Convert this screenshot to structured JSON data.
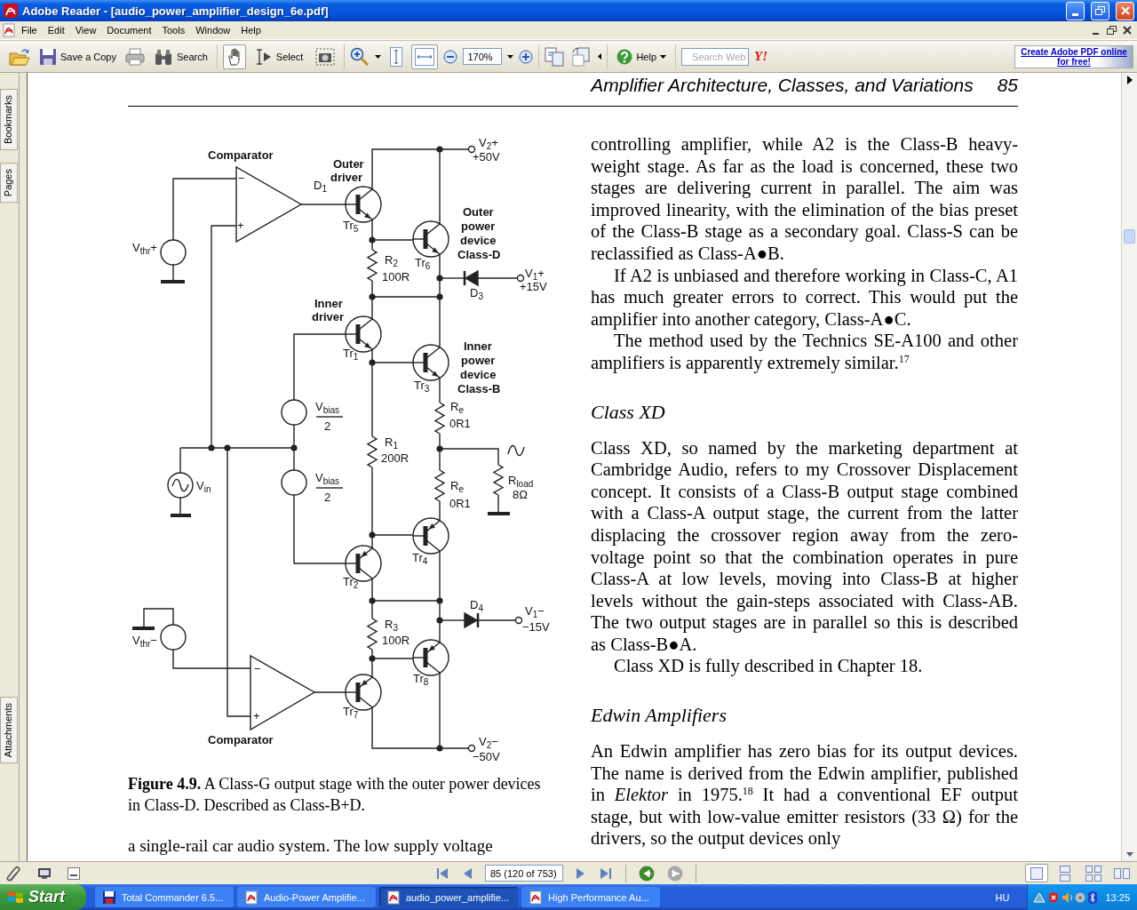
{
  "window": {
    "title": "Adobe Reader - [audio_power_amplifier_design_6e.pdf]"
  },
  "menu": [
    "File",
    "Edit",
    "View",
    "Document",
    "Tools",
    "Window",
    "Help"
  ],
  "toolbar": {
    "save_copy": "Save a Copy",
    "search": "Search",
    "tools": [
      {
        "kind": "hand",
        "selected": true
      },
      {
        "kind": "select",
        "label": "Select",
        "selected": false
      },
      {
        "kind": "snapshot",
        "selected": false
      }
    ],
    "fit": [
      {
        "kind": "page",
        "selected": false
      },
      {
        "kind": "width",
        "selected": true
      }
    ],
    "zoom": "170%",
    "help": "Help",
    "web_search": {
      "placeholder": "Search Web"
    },
    "web_logo": "Y!",
    "promo": "Create Adobe PDF online for free!"
  },
  "navigation_panel": {
    "tabs": [
      "Bookmarks",
      "Pages",
      "Attachments"
    ]
  },
  "page": {
    "header": {
      "title": "Amplifier Architecture, Classes, and Variations",
      "number": "85"
    },
    "figure": {
      "labels": [
        {
          "text": "Comparator",
          "kind": "caption"
        },
        {
          "text": "Outer",
          "kind": "caption"
        },
        {
          "text": "driver",
          "kind": "caption"
        },
        {
          "text": "D$_{1}$",
          "kind": "symbol"
        },
        {
          "text": "Tr$_{5}$",
          "kind": "symbol"
        },
        {
          "text": "Outer",
          "kind": "caption"
        },
        {
          "text": "power",
          "kind": "caption"
        },
        {
          "text": "device",
          "kind": "caption"
        },
        {
          "text": "Class-D",
          "kind": "caption"
        },
        {
          "text": "R$_{2}$",
          "kind": "symbol"
        },
        {
          "text": "100R",
          "kind": "symbol"
        },
        {
          "text": "Tr$_{6}$",
          "kind": "symbol"
        },
        {
          "text": "V$_{thr}$+",
          "kind": "symbol"
        },
        {
          "text": "V$_{2}$+",
          "kind": "symbol"
        },
        {
          "text": "+50V",
          "kind": "symbol"
        },
        {
          "text": "V$_{1}$+",
          "kind": "symbol"
        },
        {
          "text": "+15V",
          "kind": "symbol"
        },
        {
          "text": "D$_{3}$",
          "kind": "symbol"
        },
        {
          "text": "Inner",
          "kind": "caption"
        },
        {
          "text": "driver",
          "kind": "caption"
        },
        {
          "text": "Tr$_{1}$",
          "kind": "symbol"
        },
        {
          "text": "Inner",
          "kind": "caption"
        },
        {
          "text": "power",
          "kind": "caption"
        },
        {
          "text": "device",
          "kind": "caption"
        },
        {
          "text": "Class-B",
          "kind": "caption"
        },
        {
          "text": "Tr$_{3}$",
          "kind": "symbol"
        },
        {
          "text": "V$_{bias}$",
          "kind": "symbol"
        },
        {
          "text": "2",
          "kind": "symbol"
        },
        {
          "text": "R$_{e}$",
          "kind": "symbol"
        },
        {
          "text": "0R1",
          "kind": "symbol"
        },
        {
          "text": "R$_{1}$",
          "kind": "symbol"
        },
        {
          "text": "200R",
          "kind": "symbol"
        },
        {
          "text": "V$_{in}$",
          "kind": "symbol"
        },
        {
          "text": "V$_{bias}$",
          "kind": "symbol"
        },
        {
          "text": "2",
          "kind": "symbol"
        },
        {
          "text": "R$_{load}$",
          "kind": "symbol"
        },
        {
          "text": "8Ω",
          "kind": "symbol"
        },
        {
          "text": "R$_{e}$",
          "kind": "symbol"
        },
        {
          "text": "0R1",
          "kind": "symbol"
        },
        {
          "text": "Tr$_{4}$",
          "kind": "symbol"
        },
        {
          "text": "Tr$_{2}$",
          "kind": "symbol"
        },
        {
          "text": "D$_{4}$",
          "kind": "symbol"
        },
        {
          "text": "V$_{1}$−",
          "kind": "symbol"
        },
        {
          "text": "−15V",
          "kind": "symbol"
        },
        {
          "text": "R$_{3}$",
          "kind": "symbol"
        },
        {
          "text": "100R",
          "kind": "symbol"
        },
        {
          "text": "V$_{thr}$−",
          "kind": "symbol"
        },
        {
          "text": "Tr$_{8}$",
          "kind": "symbol"
        },
        {
          "text": "Tr$_{7}$",
          "kind": "symbol"
        },
        {
          "text": "Comparator",
          "kind": "caption"
        },
        {
          "text": "V$_{2}$−",
          "kind": "symbol"
        },
        {
          "text": "−50V",
          "kind": "symbol"
        },
        {
          "text": "−",
          "kind": "symbol"
        },
        {
          "text": "+",
          "kind": "symbol"
        },
        {
          "text": "−",
          "kind": "symbol"
        },
        {
          "text": "+",
          "kind": "symbol"
        }
      ],
      "caption": "**Figure 4.9.** A Class-G output stage with the outer power devices in Class-D. Described as Class-B+D."
    },
    "left_text": "a single-rail car audio system. The low supply voltage",
    "right": [
      {
        "kind": "continuation",
        "text": "controlling amplifier, while A2 is the Class-B heavy-weight stage. As far as the load is concerned, these two stages are delivering current in parallel. The aim was improved linearity, with the elimination of the bias preset of the Class-B stage as a secondary goal. Class-S can be reclassified as Class-A●B."
      },
      {
        "kind": "paragraph",
        "text": "If A2 is unbiased and therefore working in Class-C, A1 has much greater errors to correct. This would put the amplifier into another category, Class-A●C."
      },
      {
        "kind": "paragraph",
        "text": "The method used by the Technics SE-A100 and other amplifiers is apparently extremely similar.$^{17}$"
      },
      {
        "kind": "heading",
        "text": "Class XD"
      },
      {
        "kind": "continuation",
        "text": "Class XD, so named by the marketing department at Cambridge Audio, refers to my Crossover Displacement concept. It consists of a Class-B output stage combined with a Class-A output stage, the current from the latter displacing the crossover region away from the zero-voltage point so that the combination operates in pure Class-A at low levels, moving into Class-B at higher levels without the gain-steps associated with Class-AB. The two output stages are in parallel so this is described as Class-B●A."
      },
      {
        "kind": "paragraph",
        "text": "Class XD is fully described in Chapter 18."
      },
      {
        "kind": "heading",
        "text": "Edwin Amplifiers"
      },
      {
        "kind": "continuation",
        "text": "An Edwin amplifier has zero bias for its output devices. The name is derived from the Edwin amplifier, published in *Elektor* in 1975.$^{18}$ It had a conventional EF output stage, but with low-value emitter resistors (33 Ω) for the drivers, so the output devices only"
      }
    ]
  },
  "status_bar": {
    "page_field": "85 (120 of 753)",
    "history": [
      {
        "kind": "back",
        "disabled": false
      },
      {
        "kind": "forward",
        "disabled": true
      }
    ],
    "views": [
      {
        "kind": "single",
        "selected": true
      },
      {
        "kind": "continuous",
        "selected": false
      },
      {
        "kind": "facing",
        "selected": false
      },
      {
        "kind": "continuous-facing",
        "selected": false
      }
    ]
  },
  "taskbar": {
    "start": "Start",
    "tasks": [
      {
        "label": "Total Commander 6.5...",
        "kind": "floppy",
        "selected": false
      },
      {
        "label": "Audio-Power Amplifie...",
        "kind": "pdf",
        "selected": false
      },
      {
        "label": "audio_power_amplifie...",
        "kind": "pdf",
        "selected": true
      },
      {
        "label": "High Performance Au...",
        "kind": "pdf",
        "selected": false
      }
    ],
    "language": "HU",
    "clock": "13:25"
  }
}
